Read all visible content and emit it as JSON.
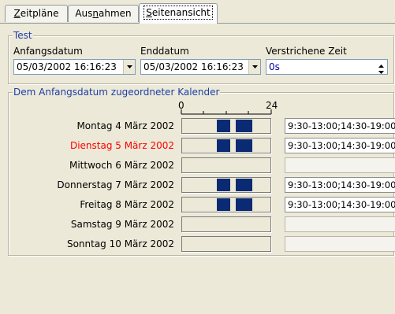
{
  "tabs": [
    {
      "label_pre": "",
      "label_ul": "Z",
      "label_post": "eitpläne",
      "active": false
    },
    {
      "label_pre": "Aus",
      "label_ul": "n",
      "label_post": "ahmen",
      "active": false
    },
    {
      "label_pre": "",
      "label_ul": "S",
      "label_post": "eitenansicht",
      "active": true
    }
  ],
  "test_group": {
    "legend": "Test",
    "start_label": "Anfangsdatum",
    "start_value": "05/03/2002 16:16:23",
    "end_label": "Enddatum",
    "end_value": "05/03/2002 16:16:23",
    "elapsed_label": "Verstrichene Zeit",
    "elapsed_value": "0s"
  },
  "calendar_group": {
    "legend": "Dem Anfangsdatum zugeordneter Kalender",
    "scale_start": "0",
    "scale_end": "24",
    "days": [
      {
        "label": "Montag 4 März 2002",
        "hours": "9:30-13:00;14:30-19:00",
        "highlight": false
      },
      {
        "label": "Dienstag 5 März 2002",
        "hours": "9:30-13:00;14:30-19:00",
        "highlight": true
      },
      {
        "label": "Mittwoch 6 März 2002",
        "hours": "",
        "highlight": false
      },
      {
        "label": "Donnerstag 7 März 2002",
        "hours": "9:30-13:00;14:30-19:00",
        "highlight": false
      },
      {
        "label": "Freitag 8 März 2002",
        "hours": "9:30-13:00;14:30-19:00",
        "highlight": false
      },
      {
        "label": "Samstag 9 März 2002",
        "hours": "",
        "highlight": false
      },
      {
        "label": "Sonntag 10 März 2002",
        "hours": "",
        "highlight": false
      }
    ]
  },
  "colors": {
    "highlight_day": "#ff0000",
    "working_block": "#0a2a73",
    "legend_text": "#1c3ea8"
  }
}
